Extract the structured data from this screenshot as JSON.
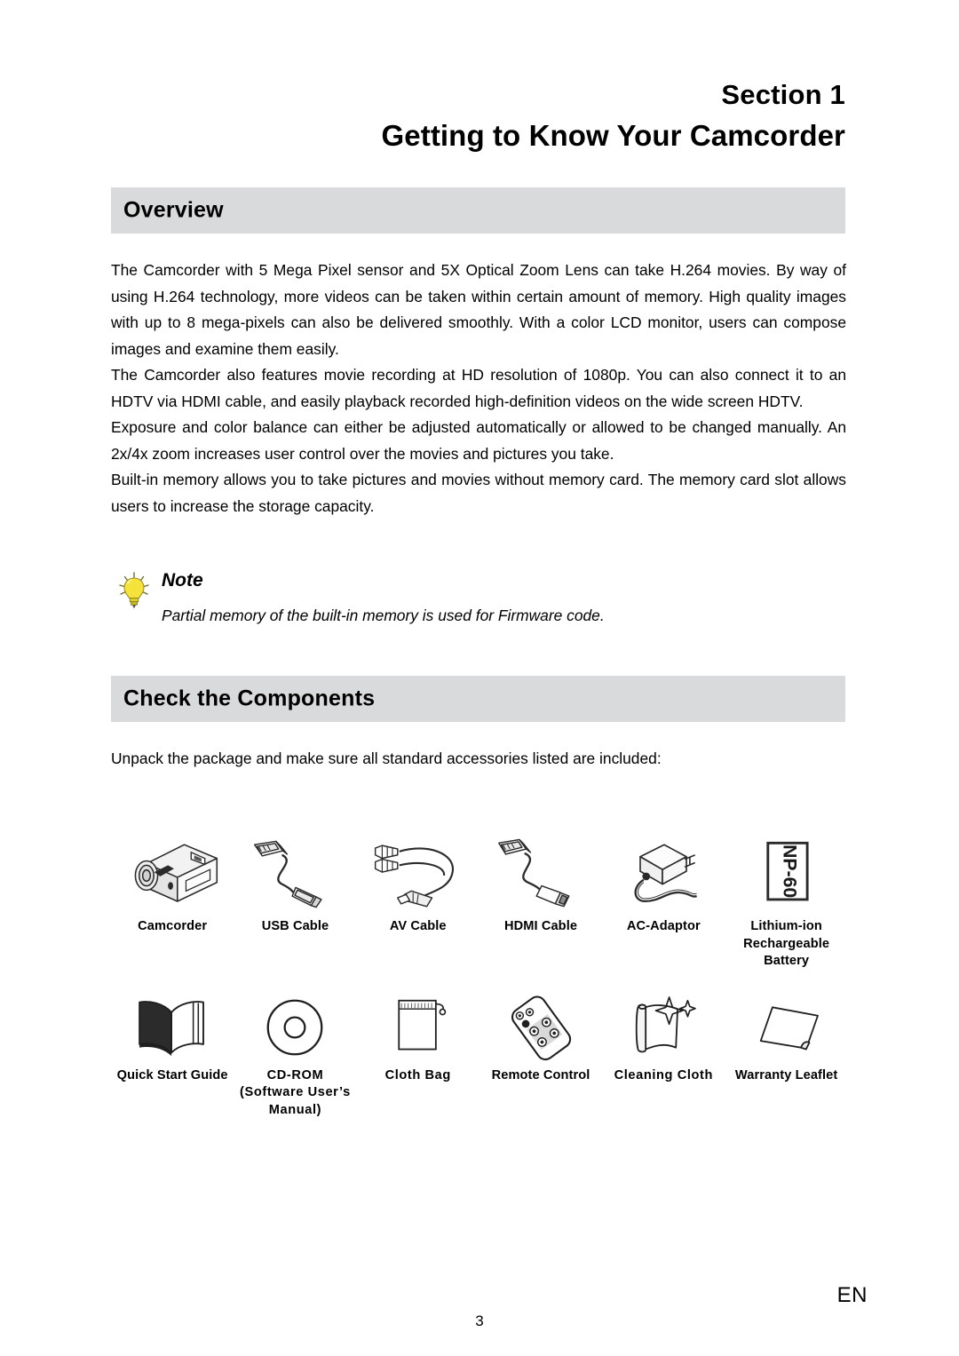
{
  "document": {
    "section_number": "Section 1",
    "section_title": "Getting to Know Your Camcorder"
  },
  "overview": {
    "heading": "Overview",
    "paragraphs": [
      "The Camcorder with 5 Mega Pixel sensor and 5X Optical Zoom Lens can take H.264 movies. By way of using H.264 technology, more videos can be taken within certain amount of memory. High quality images with up to 8 mega-pixels can also be delivered smoothly. With a color LCD monitor, users can compose images and examine them easily.",
      "The Camcorder also features  movie recording at HD resolution of 1080p. You can also connect it to an HDTV via HDMI cable, and easily playback recorded high-definition videos on the wide screen HDTV.",
      "Exposure and color balance can either be adjusted automatically or allowed to be changed manually. An 2x/4x zoom increases user control over the movies and pictures you take.",
      "Built-in memory allows you to take pictures and movies without memory card. The memory card slot allows users to increase the storage capacity."
    ]
  },
  "note": {
    "icon": "lightbulb-icon",
    "title": "Note",
    "text": "Partial memory of the built-in memory is used for Firmware code."
  },
  "components": {
    "heading": "Check the Components",
    "intro": "Unpack the package and make sure all standard accessories listed are included:",
    "rows": [
      [
        {
          "icon": "camcorder-icon",
          "label": "Camcorder"
        },
        {
          "icon": "usb-cable-icon",
          "label": "USB Cable"
        },
        {
          "icon": "av-cable-icon",
          "label": "AV Cable"
        },
        {
          "icon": "hdmi-cable-icon",
          "label": "HDMI Cable"
        },
        {
          "icon": "ac-adaptor-icon",
          "label": "AC-Adaptor"
        },
        {
          "icon": "battery-icon",
          "label": "Lithium-ion Rechargeable Battery",
          "battery_code": "NP-60"
        }
      ],
      [
        {
          "icon": "book-icon",
          "label": "Quick Start Guide"
        },
        {
          "icon": "cd-rom-icon",
          "label": "CD-ROM (Software User’s Manual)"
        },
        {
          "icon": "cloth-bag-icon",
          "label": "Cloth  Bag"
        },
        {
          "icon": "remote-control-icon",
          "label": "Remote Control"
        },
        {
          "icon": "cleaning-cloth-icon",
          "label": "Cleaning Cloth"
        },
        {
          "icon": "warranty-leaflet-icon",
          "label": "Warranty Leaflet"
        }
      ]
    ]
  },
  "footer": {
    "page_number": "3",
    "language": "EN"
  },
  "colors": {
    "header_bar": "#d9dadb",
    "text": "#000000",
    "bulb_yellow": "#f5e23a",
    "page_background": "#ffffff"
  }
}
